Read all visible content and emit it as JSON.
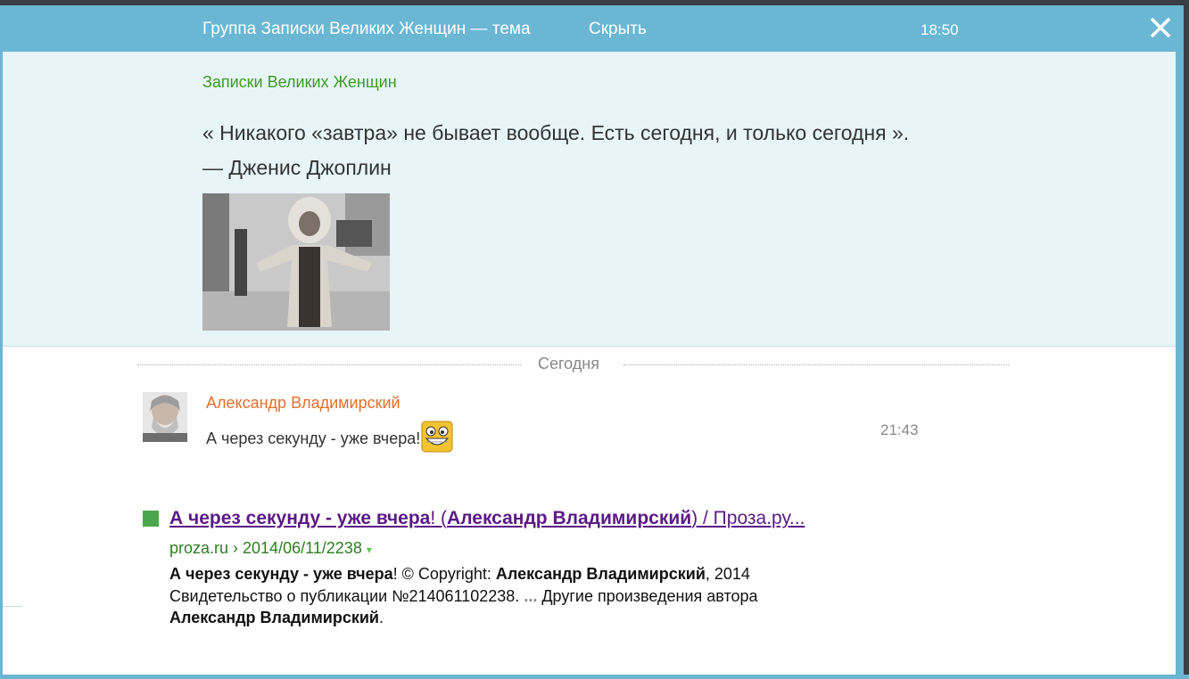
{
  "header": {
    "title": "Группа Записки Великих Женщин — тема",
    "hide_label": "Скрыть",
    "time": "18:50",
    "close_icon": "close-icon"
  },
  "post": {
    "group_name": "Записки Великих Женщин",
    "quote_line1": "« Никакого «завтра» не бывает вообще. Есть сегодня, и только сегодня ».",
    "quote_line2": "— Дженис Джоплин"
  },
  "divider": {
    "label": "Сегодня"
  },
  "comment": {
    "author": "Александр Владимирский",
    "text": "А через секунду - уже вчера!",
    "time": "21:43",
    "smiley_icon": "grinning-smiley-icon"
  },
  "search_result": {
    "title_part1": "А через секунду - уже вчера",
    "title_part2": "! (",
    "title_part3": "Александр Владимирский",
    "title_part4": ") / Проза.ру...",
    "url": "proza.ru › 2014/06/11/2238",
    "url_arrow": "▾",
    "snippet_b1": "А через секунду - уже вчера",
    "snippet_t1": "! © Copyright: ",
    "snippet_b2": "Александр Владимирский",
    "snippet_t2": ", 2014",
    "snippet_t3": "Свидетельство о публикации №214061102238. ",
    "snippet_dots": "...",
    "snippet_t4": " Другие произведения автора",
    "snippet_b3": "Александр Владимирский",
    "snippet_t5": "."
  },
  "colors": {
    "header_bg": "#6ab6d3",
    "post_bg": "#e7f4f8",
    "group_link": "#3d9b1f",
    "author": "#e36e2c",
    "result_link": "#5a1a85",
    "result_url": "#2e7d1f"
  }
}
